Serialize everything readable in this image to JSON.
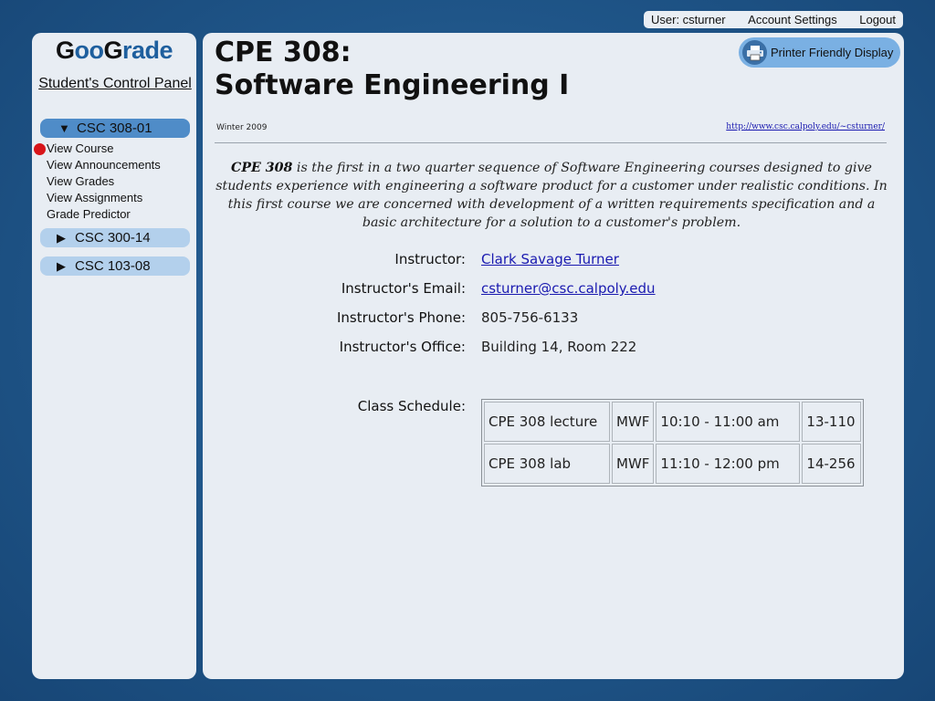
{
  "topbar": {
    "user_label": "User: csturner",
    "account_settings": "Account Settings",
    "logout": "Logout"
  },
  "sidebar": {
    "logo": {
      "part1": "G",
      "part2": "oo",
      "part3": "G",
      "part4": "rade"
    },
    "panel_title": "Student's Control Panel",
    "courses": [
      {
        "label": "CSC 308-01",
        "expanded": true,
        "items": [
          "View Course",
          "View Announcements",
          "View Grades",
          "View Assignments",
          "Grade Predictor"
        ]
      },
      {
        "label": "CSC 300-14",
        "expanded": false
      },
      {
        "label": "CSC 103-08",
        "expanded": false
      }
    ],
    "selected_item": "View Course"
  },
  "main": {
    "title_line1": "CPE 308:",
    "title_line2": "Software Engineering I",
    "printer_button": "Printer Friendly Display",
    "term": "Winter 2009",
    "site_link": "http://www.csc.calpoly.edu/~csturner/",
    "description_lead": "CPE 308",
    "description_rest": " is the first in a two quarter sequence of Software Engineering courses designed to give students experience with engineering a software product for a customer under realistic conditions.  In this first course we are concerned with development of a written requirements specification and a basic architecture for a solution to a customer's problem.",
    "instructor": {
      "label": "Instructor:",
      "value": "Clark Savage Turner"
    },
    "email": {
      "label": "Instructor's Email:",
      "value": "csturner@csc.calpoly.edu"
    },
    "phone": {
      "label": "Instructor's Phone:",
      "value": "805-756-6133"
    },
    "office": {
      "label": "Instructor's Office:",
      "value": "Building 14, Room 222"
    },
    "schedule_label": "Class Schedule:",
    "schedule": [
      [
        "CPE 308 lecture",
        "MWF",
        "10:10  - 11:00 am",
        "13-110"
      ],
      [
        "CPE 308 lab",
        "MWF",
        "11:10  - 12:00 pm",
        "14-256"
      ]
    ]
  },
  "colors": {
    "background": "#1f5588",
    "panel": "#e8edf3",
    "active_course": "#4f8cc8",
    "inactive_course": "#b3d0ec",
    "link": "#1a1ab0",
    "selected_dot": "#d8151a"
  }
}
